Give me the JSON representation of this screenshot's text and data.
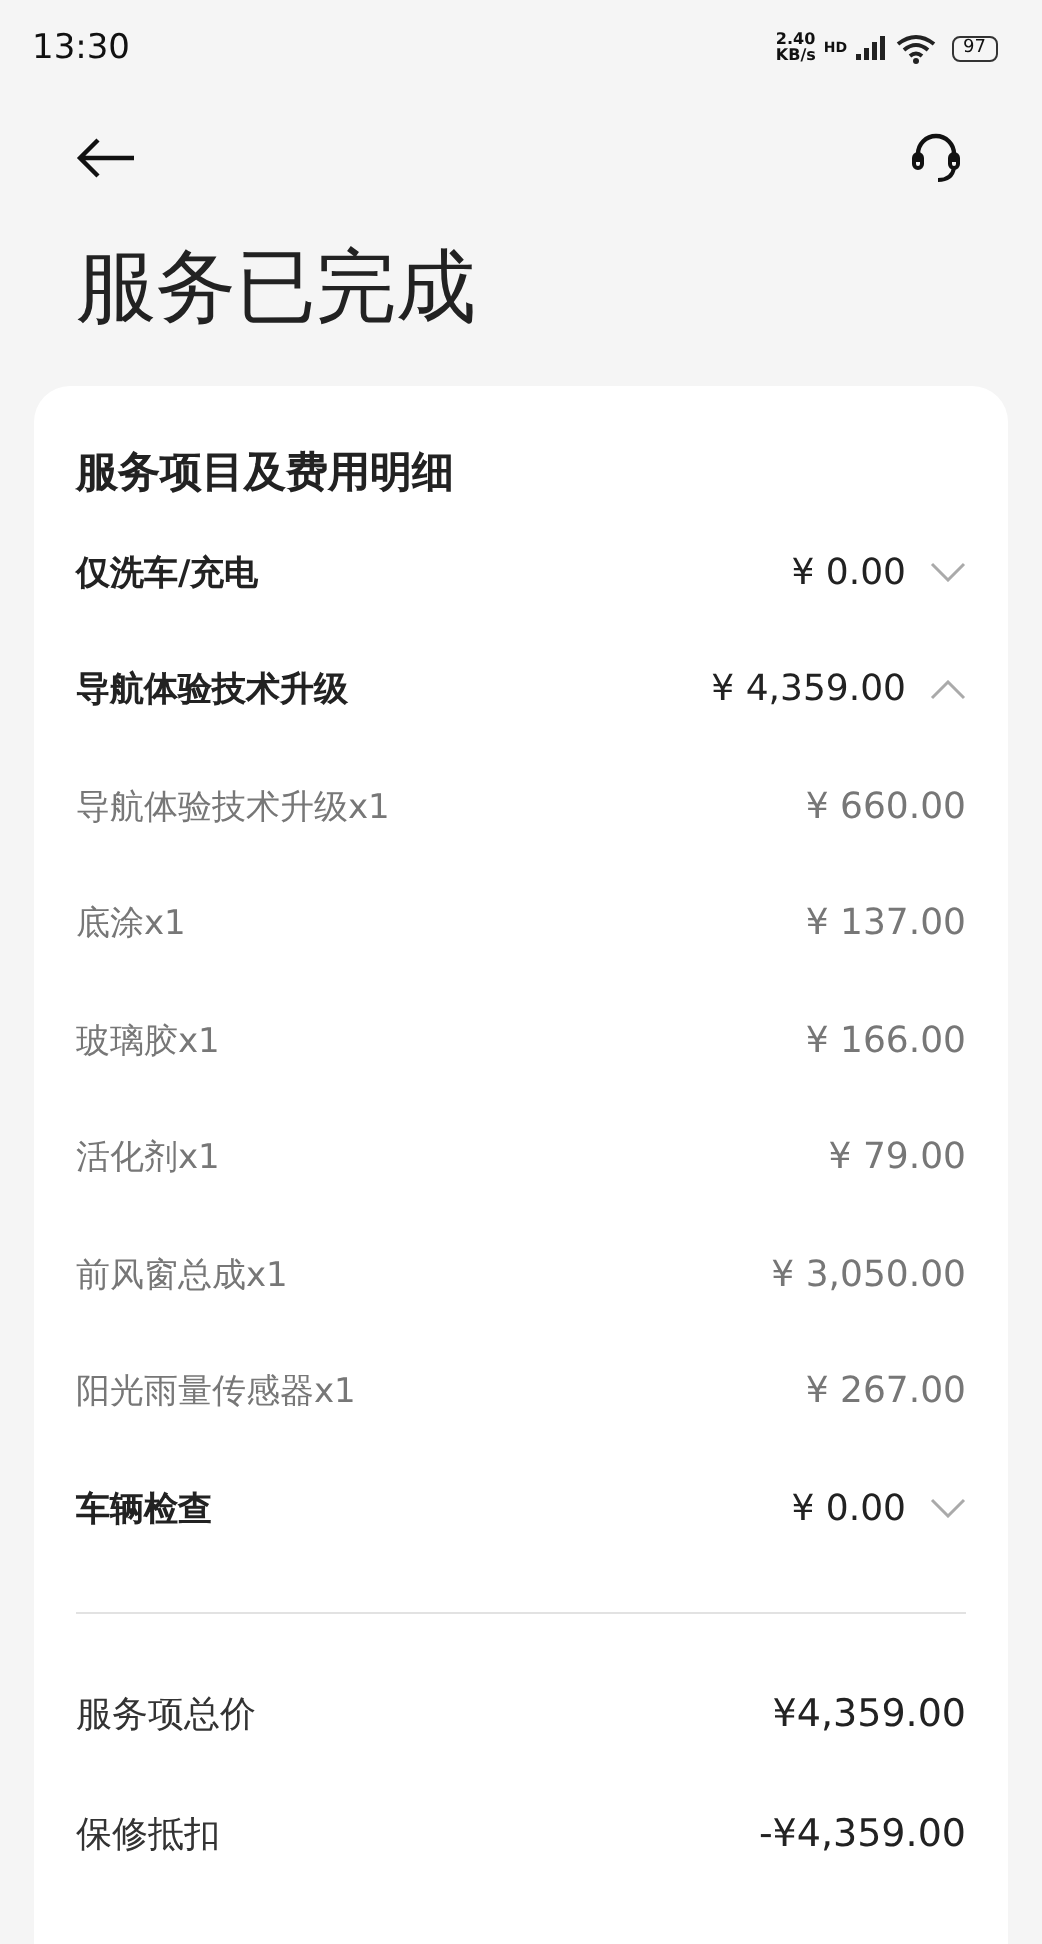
{
  "status_bar": {
    "time": "13:30",
    "net_speed": "2.40",
    "net_unit": "KB/s",
    "hd": "HD",
    "battery": "97"
  },
  "page_title": "服务已完成",
  "card": {
    "title": "服务项目及费用明细",
    "groups": [
      {
        "name": "仅洗车/充电",
        "amount": "¥ 0.00",
        "expanded": false
      },
      {
        "name": "导航体验技术升级",
        "amount": "¥ 4,359.00",
        "expanded": true,
        "items": [
          {
            "name": "导航体验技术升级x1",
            "amount": "¥ 660.00"
          },
          {
            "name": "底涂x1",
            "amount": "¥ 137.00"
          },
          {
            "name": "玻璃胶x1",
            "amount": "¥ 166.00"
          },
          {
            "name": "活化剂x1",
            "amount": "¥ 79.00"
          },
          {
            "name": "前风窗总成x1",
            "amount": "¥ 3,050.00"
          },
          {
            "name": "阳光雨量传感器x1",
            "amount": "¥ 267.00"
          }
        ]
      },
      {
        "name": "车辆检查",
        "amount": "¥ 0.00",
        "expanded": false
      }
    ],
    "summary": [
      {
        "label": "服务项总价",
        "value": "¥4,359.00"
      },
      {
        "label": "保修抵扣",
        "value": "-¥4,359.00"
      }
    ]
  }
}
